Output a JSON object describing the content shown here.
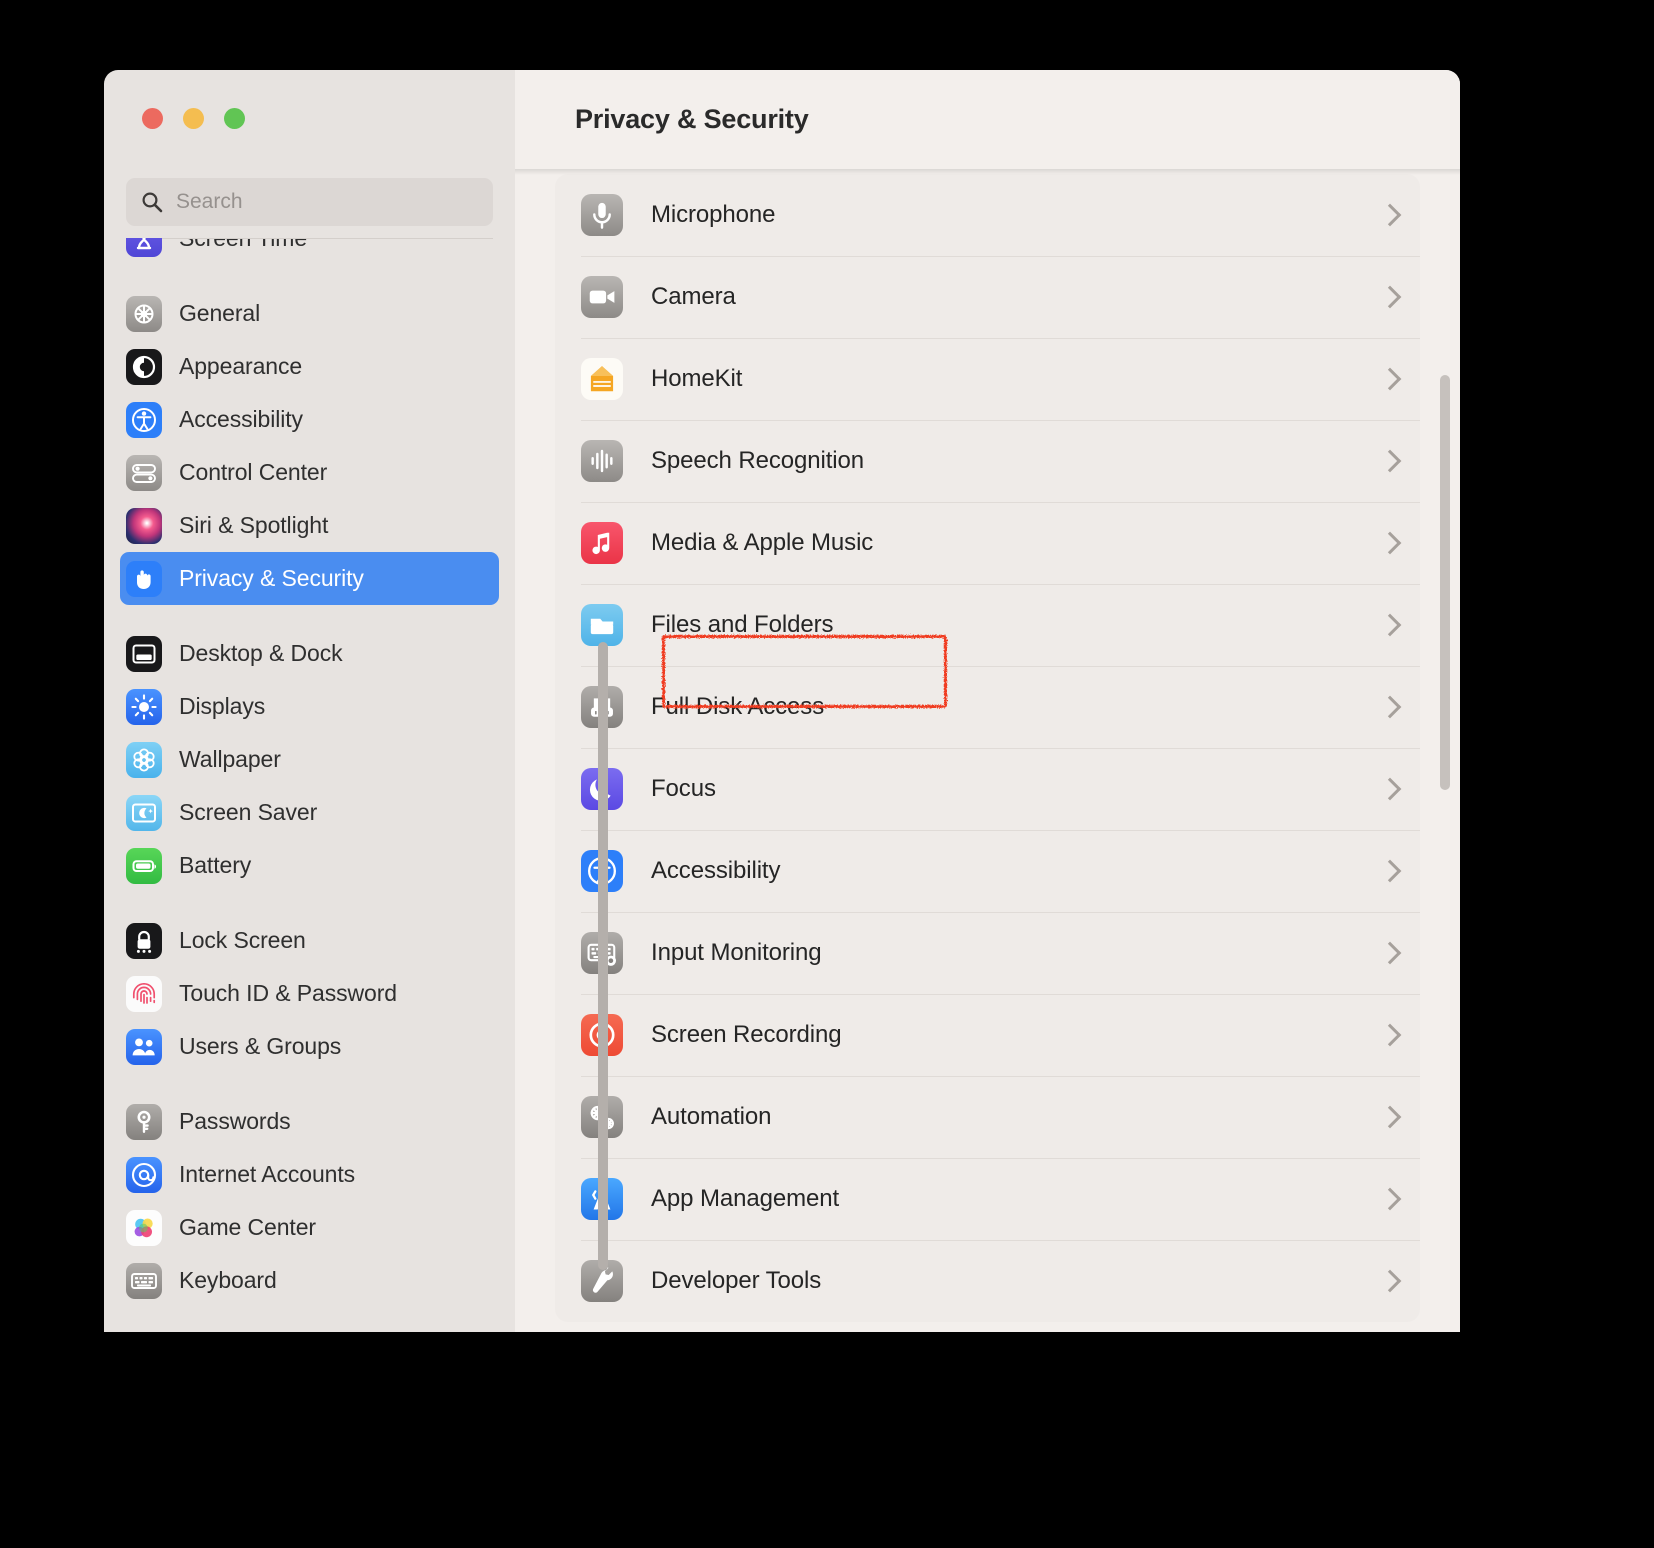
{
  "window": {
    "traffic_lights": [
      "close",
      "minimize",
      "zoom"
    ]
  },
  "search": {
    "placeholder": "Search",
    "value": "",
    "icon": "search-icon"
  },
  "sidebar": {
    "groups": [
      {
        "items": [
          {
            "label": "Screen Time",
            "icon": "screen-time-icon",
            "selected": false,
            "clipped": true
          }
        ]
      },
      {
        "items": [
          {
            "label": "General",
            "icon": "general-gear-icon",
            "selected": false
          },
          {
            "label": "Appearance",
            "icon": "appearance-icon",
            "selected": false
          },
          {
            "label": "Accessibility",
            "icon": "accessibility-icon",
            "selected": false
          },
          {
            "label": "Control Center",
            "icon": "control-center-icon",
            "selected": false
          },
          {
            "label": "Siri & Spotlight",
            "icon": "siri-icon",
            "selected": false
          },
          {
            "label": "Privacy & Security",
            "icon": "privacy-hand-icon",
            "selected": true
          }
        ]
      },
      {
        "items": [
          {
            "label": "Desktop & Dock",
            "icon": "desktop-dock-icon",
            "selected": false
          },
          {
            "label": "Displays",
            "icon": "displays-icon",
            "selected": false
          },
          {
            "label": "Wallpaper",
            "icon": "wallpaper-icon",
            "selected": false
          },
          {
            "label": "Screen Saver",
            "icon": "screen-saver-icon",
            "selected": false
          },
          {
            "label": "Battery",
            "icon": "battery-icon",
            "selected": false
          }
        ]
      },
      {
        "items": [
          {
            "label": "Lock Screen",
            "icon": "lock-screen-icon",
            "selected": false
          },
          {
            "label": "Touch ID & Password",
            "icon": "touch-id-icon",
            "selected": false
          },
          {
            "label": "Users & Groups",
            "icon": "users-groups-icon",
            "selected": false
          }
        ]
      },
      {
        "items": [
          {
            "label": "Passwords",
            "icon": "passwords-key-icon",
            "selected": false
          },
          {
            "label": "Internet Accounts",
            "icon": "internet-accounts-icon",
            "selected": false
          },
          {
            "label": "Game Center",
            "icon": "game-center-icon",
            "selected": false
          },
          {
            "label": "Keyboard",
            "icon": "keyboard-icon",
            "selected": false,
            "clipped": true
          }
        ]
      }
    ]
  },
  "main": {
    "title": "Privacy & Security",
    "rows": [
      {
        "label": "Microphone",
        "icon": "microphone-icon",
        "chevron": "chevron-right-icon",
        "highlighted": false
      },
      {
        "label": "Camera",
        "icon": "camera-icon",
        "chevron": "chevron-right-icon",
        "highlighted": false
      },
      {
        "label": "HomeKit",
        "icon": "homekit-icon",
        "chevron": "chevron-right-icon",
        "highlighted": false
      },
      {
        "label": "Speech Recognition",
        "icon": "speech-recognition-icon",
        "chevron": "chevron-right-icon",
        "highlighted": false
      },
      {
        "label": "Media & Apple Music",
        "icon": "media-apple-music-icon",
        "chevron": "chevron-right-icon",
        "highlighted": false
      },
      {
        "label": "Files and Folders",
        "icon": "files-and-folders-icon",
        "chevron": "chevron-right-icon",
        "highlighted": true
      },
      {
        "label": "Full Disk Access",
        "icon": "full-disk-access-icon",
        "chevron": "chevron-right-icon",
        "highlighted": false
      },
      {
        "label": "Focus",
        "icon": "focus-icon",
        "chevron": "chevron-right-icon",
        "highlighted": false
      },
      {
        "label": "Accessibility",
        "icon": "accessibility-icon",
        "chevron": "chevron-right-icon",
        "highlighted": false
      },
      {
        "label": "Input Monitoring",
        "icon": "input-monitoring-icon",
        "chevron": "chevron-right-icon",
        "highlighted": false
      },
      {
        "label": "Screen Recording",
        "icon": "screen-recording-icon",
        "chevron": "chevron-right-icon",
        "highlighted": false
      },
      {
        "label": "Automation",
        "icon": "automation-icon",
        "chevron": "chevron-right-icon",
        "highlighted": false
      },
      {
        "label": "App Management",
        "icon": "app-management-icon",
        "chevron": "chevron-right-icon",
        "highlighted": false
      },
      {
        "label": "Developer Tools",
        "icon": "developer-tools-icon",
        "chevron": "chevron-right-icon",
        "highlighted": false
      }
    ]
  },
  "annotation": {
    "target": "Files and Folders",
    "color": "#f03c20"
  },
  "colors": {
    "selection_blue": "#4a8df0",
    "sidebar_bg": "#e7e3e0",
    "main_bg": "#f3efec",
    "card_bg": "#efebe8",
    "annotation_red": "#f03c20",
    "traffic_red": "#ec6a5f",
    "traffic_yellow": "#f4bd50",
    "traffic_green": "#61c554"
  }
}
